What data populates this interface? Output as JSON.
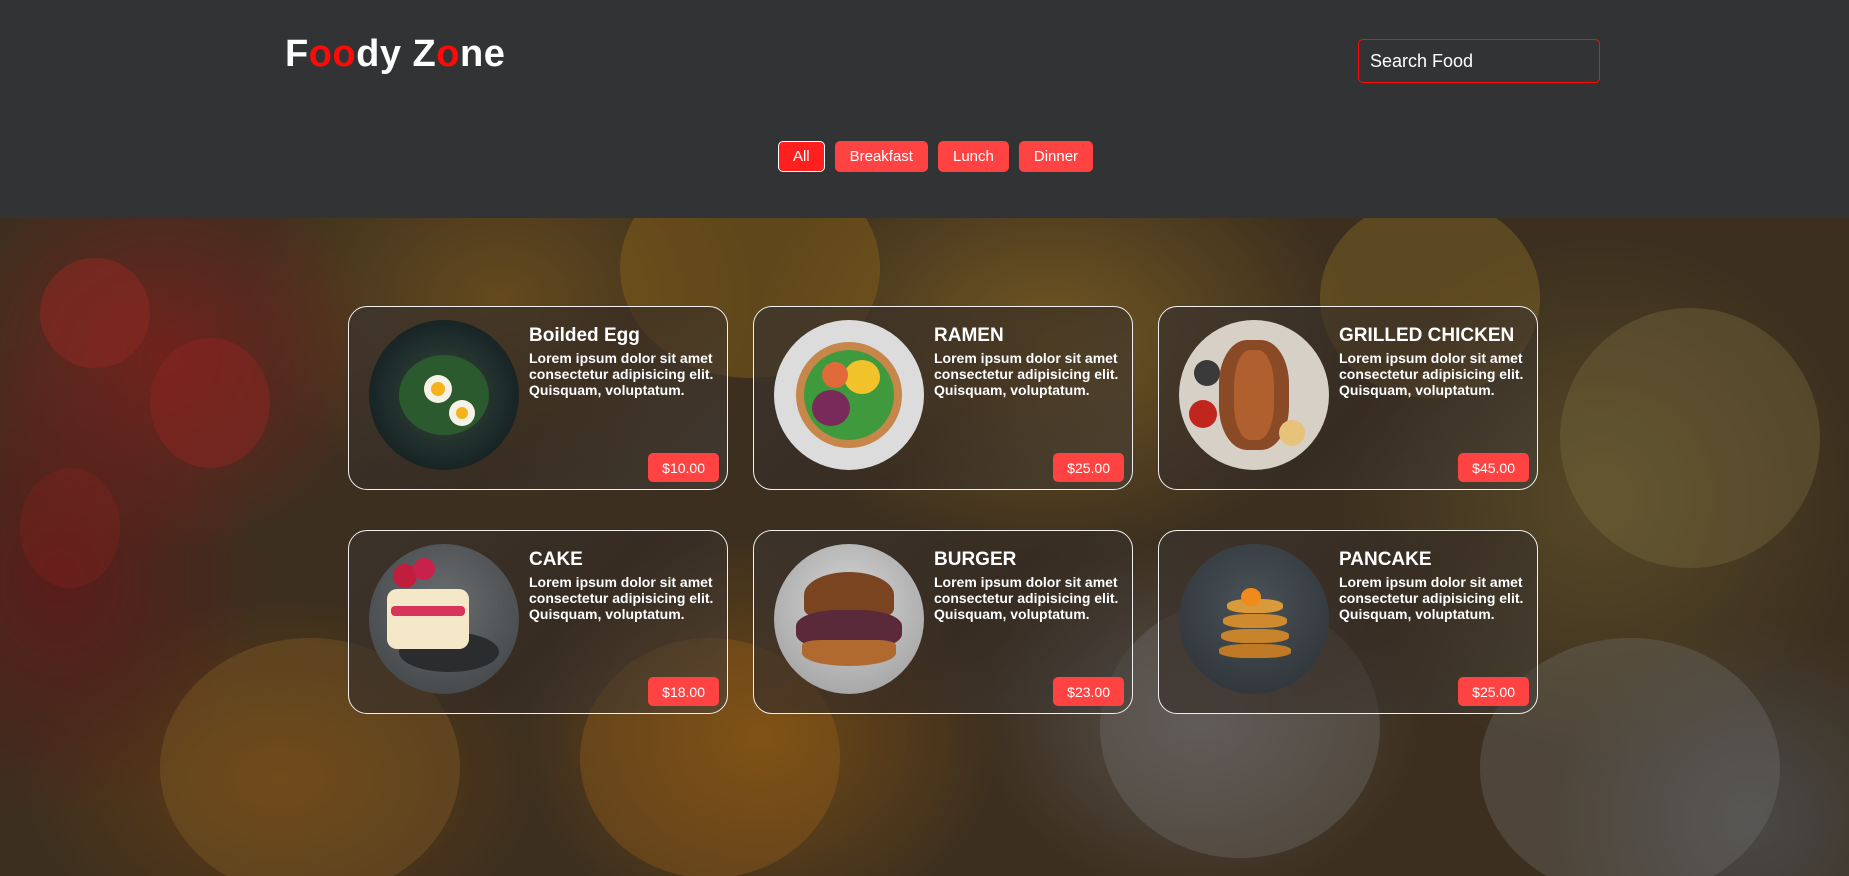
{
  "header": {
    "logo_parts": [
      "F",
      "oo",
      "dy Z",
      "o",
      "ne"
    ],
    "search_placeholder": "Search Food",
    "accent_color": "#ff0909",
    "button_color": "#ff4343"
  },
  "filters": {
    "items": [
      {
        "label": "All",
        "active": true
      },
      {
        "label": "Breakfast",
        "active": false
      },
      {
        "label": "Lunch",
        "active": false
      },
      {
        "label": "Dinner",
        "active": false
      }
    ]
  },
  "foods": [
    {
      "name": "Boilded Egg",
      "description": "Lorem ipsum dolor sit amet consectetur adipisicing elit. Quisquam, voluptatum.",
      "price": "$10.00"
    },
    {
      "name": "RAMEN",
      "description": "Lorem ipsum dolor sit amet consectetur adipisicing elit. Quisquam, voluptatum.",
      "price": "$25.00"
    },
    {
      "name": "GRILLED CHICKEN",
      "description": "Lorem ipsum dolor sit amet consectetur adipisicing elit. Quisquam, voluptatum.",
      "price": "$45.00"
    },
    {
      "name": "CAKE",
      "description": "Lorem ipsum dolor sit amet consectetur adipisicing elit. Quisquam, voluptatum.",
      "price": "$18.00"
    },
    {
      "name": "BURGER",
      "description": "Lorem ipsum dolor sit amet consectetur adipisicing elit. Quisquam, voluptatum.",
      "price": "$23.00"
    },
    {
      "name": "PANCAKE",
      "description": "Lorem ipsum dolor sit amet consectetur adipisicing elit. Quisquam, voluptatum.",
      "price": "$25.00"
    }
  ]
}
